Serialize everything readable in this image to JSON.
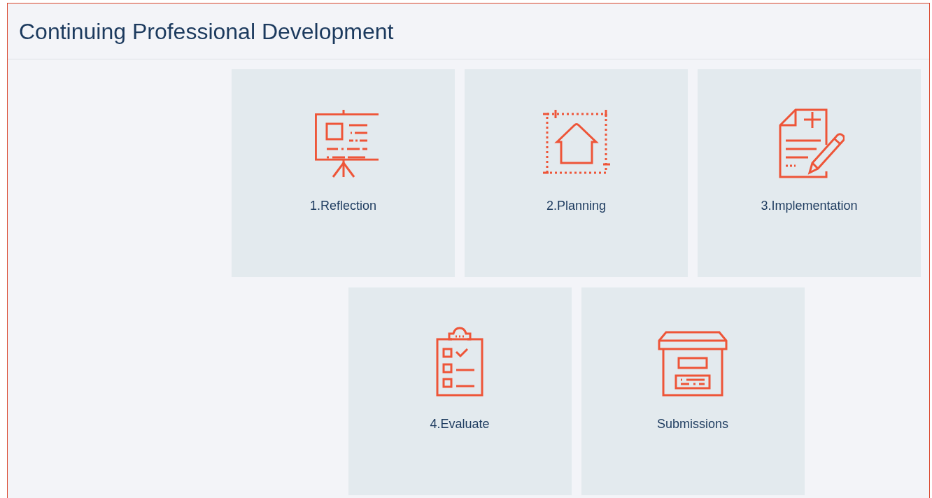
{
  "header": {
    "title": "Continuing Professional Development"
  },
  "tiles": [
    {
      "label": "1.Reflection",
      "kind": "presentation"
    },
    {
      "label": "2.Planning",
      "kind": "plan"
    },
    {
      "label": "3.Implementation",
      "kind": "document"
    },
    {
      "label": "4.Evaluate",
      "kind": "checklist"
    },
    {
      "label": "Submissions",
      "kind": "archive"
    }
  ]
}
